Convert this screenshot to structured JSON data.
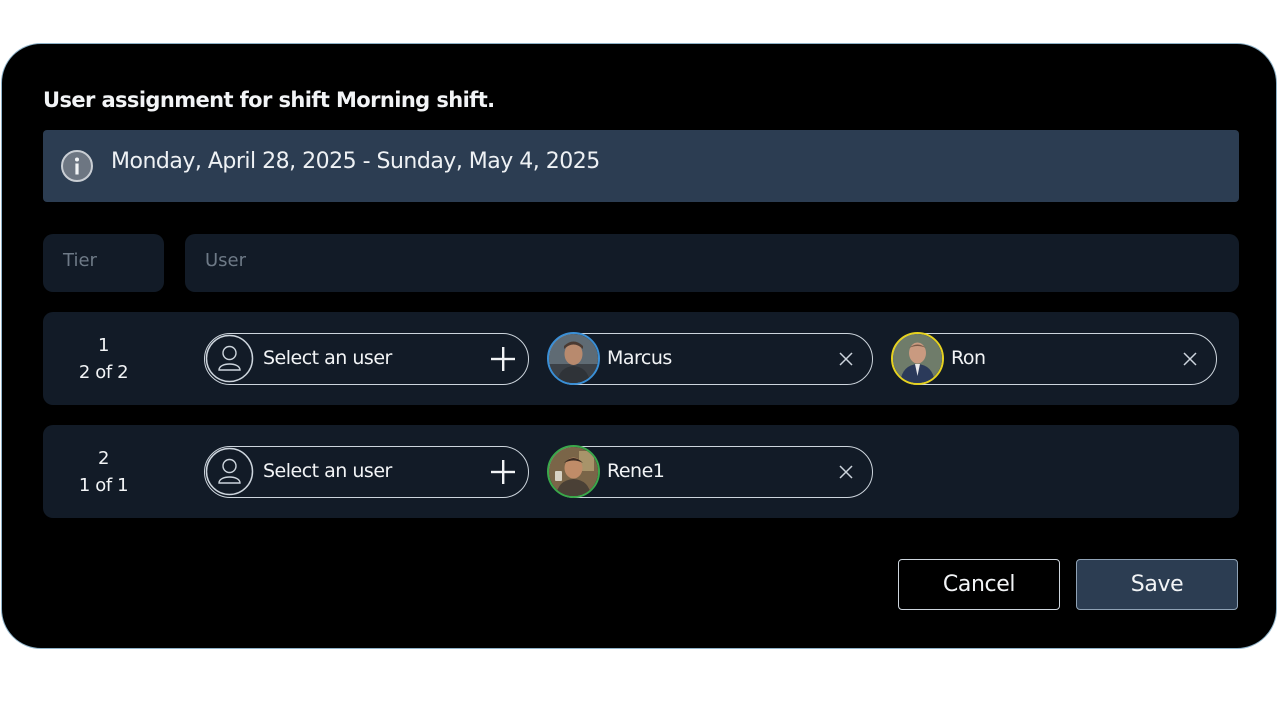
{
  "dialog": {
    "title": "User assignment for shift Morning shift.",
    "date_range": "Monday, April 28, 2025 - Sunday, May 4, 2025",
    "info_icon": "info-icon"
  },
  "table_header": {
    "tier_label": "Tier",
    "user_label": "User"
  },
  "tiers": [
    {
      "number": "1",
      "count": "2 of 2",
      "select_placeholder": "Select an user",
      "users": [
        {
          "name": "Marcus",
          "ring_color": "#3a8fd6"
        },
        {
          "name": "Ron",
          "ring_color": "#e6d21f"
        }
      ]
    },
    {
      "number": "2",
      "count": "1 of 1",
      "select_placeholder": "Select an user",
      "users": [
        {
          "name": "Rene1",
          "ring_color": "#3aa84a"
        }
      ]
    }
  ],
  "actions": {
    "cancel_label": "Cancel",
    "save_label": "Save"
  },
  "colors": {
    "dialog_background": "#000000",
    "banner_background": "#2c3d52",
    "row_background": "#121b27",
    "save_button": "#2c3d52"
  }
}
